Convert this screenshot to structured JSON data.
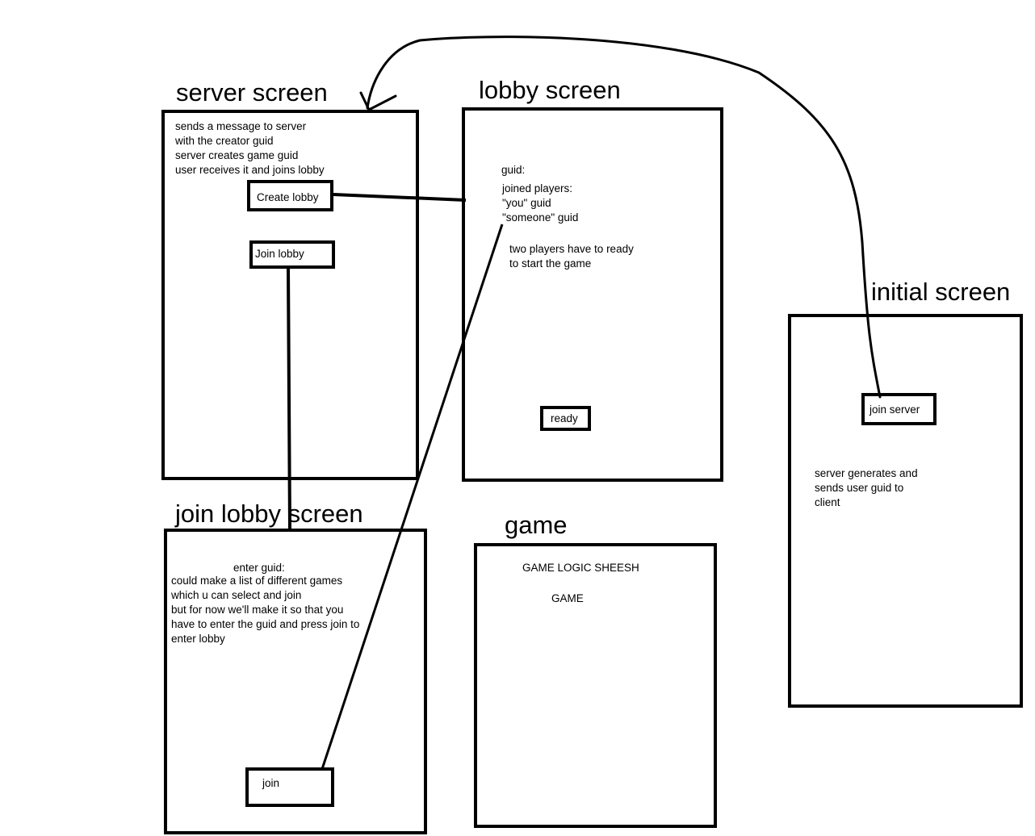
{
  "screens": {
    "server": {
      "title": "server screen",
      "description": "sends a message to server\nwith the creator guid\nserver creates game guid\nuser receives it and joins lobby",
      "create_lobby_label": "Create lobby",
      "join_lobby_label": "Join lobby"
    },
    "lobby": {
      "title": "lobby screen",
      "guid_label": "guid:",
      "players_text": "joined players:\n\"you\" guid\n\"someone\" guid",
      "ready_note": "two players have to ready\nto start the game",
      "ready_label": "ready"
    },
    "initial": {
      "title": "initial screen",
      "join_server_label": "join server",
      "description": "server generates and\nsends user guid to\nclient"
    },
    "join_lobby": {
      "title": "join lobby screen",
      "guid_prompt": "enter guid:",
      "description": "could make a list of different games\nwhich u can select and join\nbut for now we'll make it so that you\nhave to enter the guid and press join to\nenter lobby",
      "join_label": "join"
    },
    "game": {
      "title": "game",
      "logic_text": "GAME LOGIC SHEESH",
      "game_text": "GAME"
    }
  },
  "connectors": [
    {
      "from": "join-server-button",
      "to": "server-screen-frame",
      "style": "arrow"
    },
    {
      "from": "create-lobby-button",
      "to": "lobby-screen-frame",
      "style": "line"
    },
    {
      "from": "join-lobby-button",
      "to": "join-lobby-screen-frame",
      "style": "line"
    },
    {
      "from": "join-button",
      "to": "lobby-screen-frame",
      "style": "line"
    }
  ]
}
